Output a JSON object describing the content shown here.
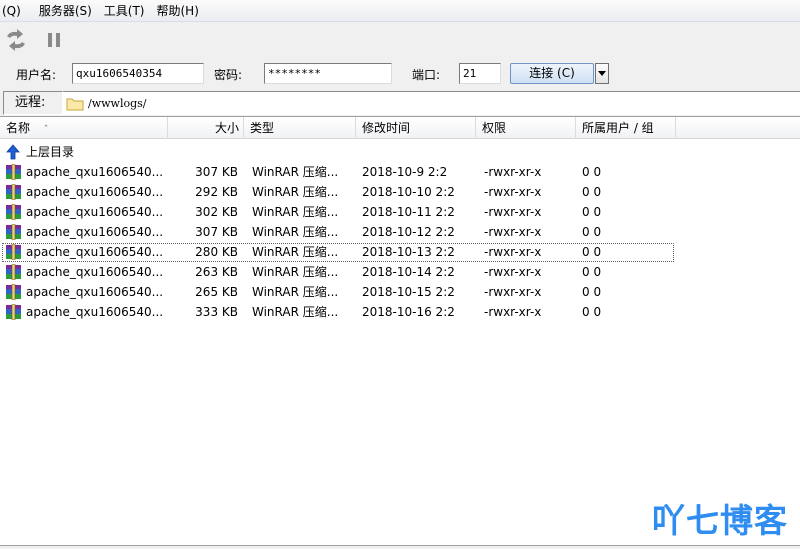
{
  "menu": [
    "(Q)",
    "服务器(S)",
    "工具(T)",
    "帮助(H)"
  ],
  "toolbar": {
    "buttons": [
      "refresh-icon",
      "pause-icon"
    ]
  },
  "login": {
    "username_label": "用户名:",
    "username_value": "qxu1606540354",
    "password_label": "密码:",
    "password_value": "********",
    "port_label": "端口:",
    "port_value": "21",
    "connect_label": "连接 (C)"
  },
  "remote": {
    "label": "远程:",
    "path": "/wwwlogs/"
  },
  "columns": [
    "名称",
    "大小",
    "类型",
    "修改时间",
    "权限",
    "所属用户 / 组"
  ],
  "parent_dir": "上层目录",
  "files": [
    {
      "name": "apache_qxu1606540...",
      "size": "307 KB",
      "type": "WinRAR 压缩...",
      "modified": "2018-10-9 2:2",
      "perm": "-rwxr-xr-x",
      "owner": "0 0"
    },
    {
      "name": "apache_qxu1606540...",
      "size": "292 KB",
      "type": "WinRAR 压缩...",
      "modified": "2018-10-10 2:2",
      "perm": "-rwxr-xr-x",
      "owner": "0 0"
    },
    {
      "name": "apache_qxu1606540...",
      "size": "302 KB",
      "type": "WinRAR 压缩...",
      "modified": "2018-10-11 2:2",
      "perm": "-rwxr-xr-x",
      "owner": "0 0"
    },
    {
      "name": "apache_qxu1606540...",
      "size": "307 KB",
      "type": "WinRAR 压缩...",
      "modified": "2018-10-12 2:2",
      "perm": "-rwxr-xr-x",
      "owner": "0 0"
    },
    {
      "name": "apache_qxu1606540...",
      "size": "280 KB",
      "type": "WinRAR 压缩...",
      "modified": "2018-10-13 2:2",
      "perm": "-rwxr-xr-x",
      "owner": "0 0"
    },
    {
      "name": "apache_qxu1606540...",
      "size": "263 KB",
      "type": "WinRAR 压缩...",
      "modified": "2018-10-14 2:2",
      "perm": "-rwxr-xr-x",
      "owner": "0 0"
    },
    {
      "name": "apache_qxu1606540...",
      "size": "265 KB",
      "type": "WinRAR 压缩...",
      "modified": "2018-10-15 2:2",
      "perm": "-rwxr-xr-x",
      "owner": "0 0"
    },
    {
      "name": "apache_qxu1606540...",
      "size": "333 KB",
      "type": "WinRAR 压缩...",
      "modified": "2018-10-16 2:2",
      "perm": "-rwxr-xr-x",
      "owner": "0 0"
    }
  ],
  "selected_row": 4,
  "watermark": "吖七博客",
  "colors": {
    "accent": "#6f93c4",
    "watermark": "#2f8cf0",
    "parent_arrow": "#1e5fd8"
  }
}
